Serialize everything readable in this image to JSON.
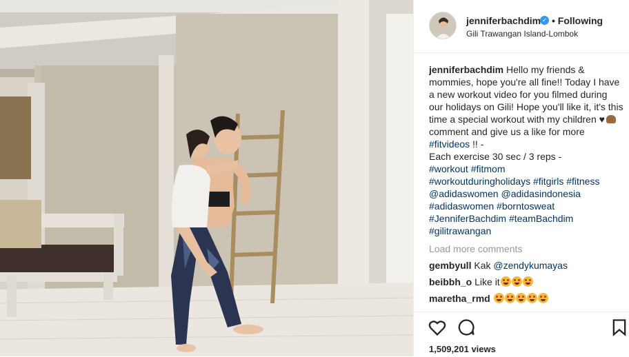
{
  "header": {
    "username": "jenniferbachdim",
    "follow_status": "• Following",
    "location": "Gili Trawangan Island-Lombok"
  },
  "caption": {
    "username": "jenniferbachdim",
    "text_1": "Hello my friends & mommies, hope you're all fine!! Today I have a new workout video for you filmed during our holidays on Gili! Hope you'll like it, it's this time a special workout with my children",
    "text_2": "comment and give us a like for more",
    "tag_fitvideos": "#fitvideos",
    "text_3": "!! -",
    "text_4": "Each exercise 30 sec / 3 reps -",
    "hashtags_1": "#workout #fitmom",
    "hashtags_2": "#workoutduringholidays #fitgirls #fitness",
    "hashtags_3": "@adidaswomen @adidasindonesia",
    "hashtags_4": "#adidaswomen #borntosweat",
    "hashtags_5": "#JenniferBachdim #teamBachdim",
    "hashtags_6": "#gilitrawangan"
  },
  "load_more": "Load more comments",
  "comment_list": [
    {
      "user": "gembyull",
      "text": "Kak ",
      "mention": "@zendykumayas"
    },
    {
      "user": "beibbh_o",
      "text": "Like it"
    },
    {
      "user": "maretha_rmd",
      "text": ""
    }
  ],
  "footer": {
    "views": "1,509,201 views"
  },
  "icons": {
    "heart": "heart-icon",
    "comment": "comment-icon",
    "bookmark": "bookmark-icon",
    "verified": "verified-badge-icon"
  },
  "colors": {
    "link": "#003569",
    "verified": "#3897f0",
    "muted": "#999999",
    "text": "#262626"
  }
}
